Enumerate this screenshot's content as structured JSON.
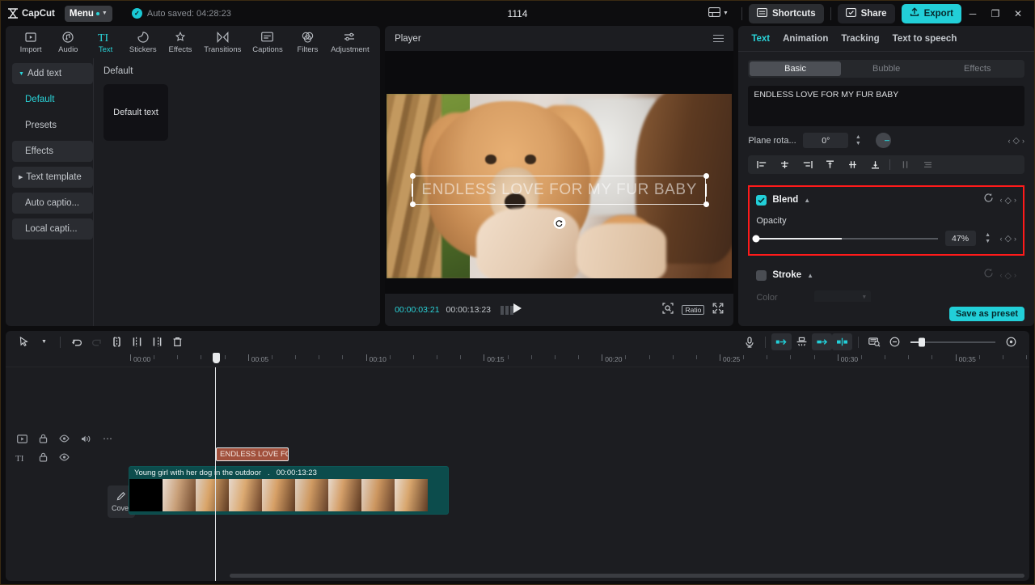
{
  "titlebar": {
    "app_name": "CapCut",
    "menu_label": "Menu",
    "autosave": "Auto saved: 04:28:23",
    "project_title": "1114",
    "shortcuts_label": "Shortcuts",
    "share_label": "Share",
    "export_label": "Export",
    "minimize": "─",
    "maximize": "❐",
    "close": "✕",
    "accent_color": "#22cfd8"
  },
  "left_panel": {
    "tabs": [
      {
        "label": "Import",
        "icon": "import-icon",
        "active": false
      },
      {
        "label": "Audio",
        "icon": "audio-icon",
        "active": false
      },
      {
        "label": "Text",
        "icon": "text-icon",
        "active": true
      },
      {
        "label": "Stickers",
        "icon": "stickers-icon",
        "active": false
      },
      {
        "label": "Effects",
        "icon": "effects-icon",
        "active": false
      },
      {
        "label": "Transitions",
        "icon": "transitions-icon",
        "active": false
      },
      {
        "label": "Captions",
        "icon": "captions-icon",
        "active": false
      },
      {
        "label": "Filters",
        "icon": "filters-icon",
        "active": false
      },
      {
        "label": "Adjustment",
        "icon": "adjustment-icon",
        "active": false
      }
    ],
    "nav": [
      {
        "label": "Add text",
        "style": "box",
        "selected": false,
        "caret": true
      },
      {
        "label": "Default",
        "style": "plain",
        "selected": true,
        "caret": false
      },
      {
        "label": "Presets",
        "style": "plain",
        "selected": false,
        "caret": false
      },
      {
        "label": "Effects",
        "style": "box",
        "selected": false,
        "caret": false
      },
      {
        "label": "Text template",
        "style": "box",
        "selected": false,
        "caret": true
      },
      {
        "label": "Auto captio...",
        "style": "box",
        "selected": false,
        "caret": false
      },
      {
        "label": "Local capti...",
        "style": "box",
        "selected": false,
        "caret": false
      }
    ],
    "section_title": "Default",
    "card_label": "Default text"
  },
  "player": {
    "header_title": "Player",
    "overlay_text": "ENDLESS LOVE FOR MY FUR BABY",
    "current_time": "00:00:03:21",
    "total_time": "00:00:13:23",
    "ratio_label": "Ratio"
  },
  "right_panel": {
    "tabs": [
      {
        "label": "Text",
        "active": true
      },
      {
        "label": "Animation",
        "active": false
      },
      {
        "label": "Tracking",
        "active": false
      },
      {
        "label": "Text to speech",
        "active": false
      }
    ],
    "segments": [
      {
        "label": "Basic",
        "active": true
      },
      {
        "label": "Bubble",
        "active": false
      },
      {
        "label": "Effects",
        "active": false
      }
    ],
    "text_value": "ENDLESS LOVE FOR MY FUR BABY",
    "plane_rotation_label": "Plane rota...",
    "plane_rotation_value": "0°",
    "blend": {
      "title": "Blend",
      "enabled": true,
      "opacity_label": "Opacity",
      "opacity_value": "47%",
      "opacity_percent": 47,
      "highlight_color": "#ff1a1a"
    },
    "stroke": {
      "title": "Stroke",
      "enabled": false,
      "color_label": "Color"
    },
    "save_preset_label": "Save as preset"
  },
  "timeline": {
    "ruler_labels": [
      "00:00",
      "00:05",
      "00:10",
      "00:15",
      "00:20",
      "00:25",
      "00:30",
      "00:35"
    ],
    "text_clip_label": "ENDLESS LOVE FO",
    "video_clip_label": "Young girl with her dog in the outdoor",
    "video_clip_separator": ".",
    "video_clip_duration": "00:00:13:23",
    "cover_label": "Cover"
  }
}
